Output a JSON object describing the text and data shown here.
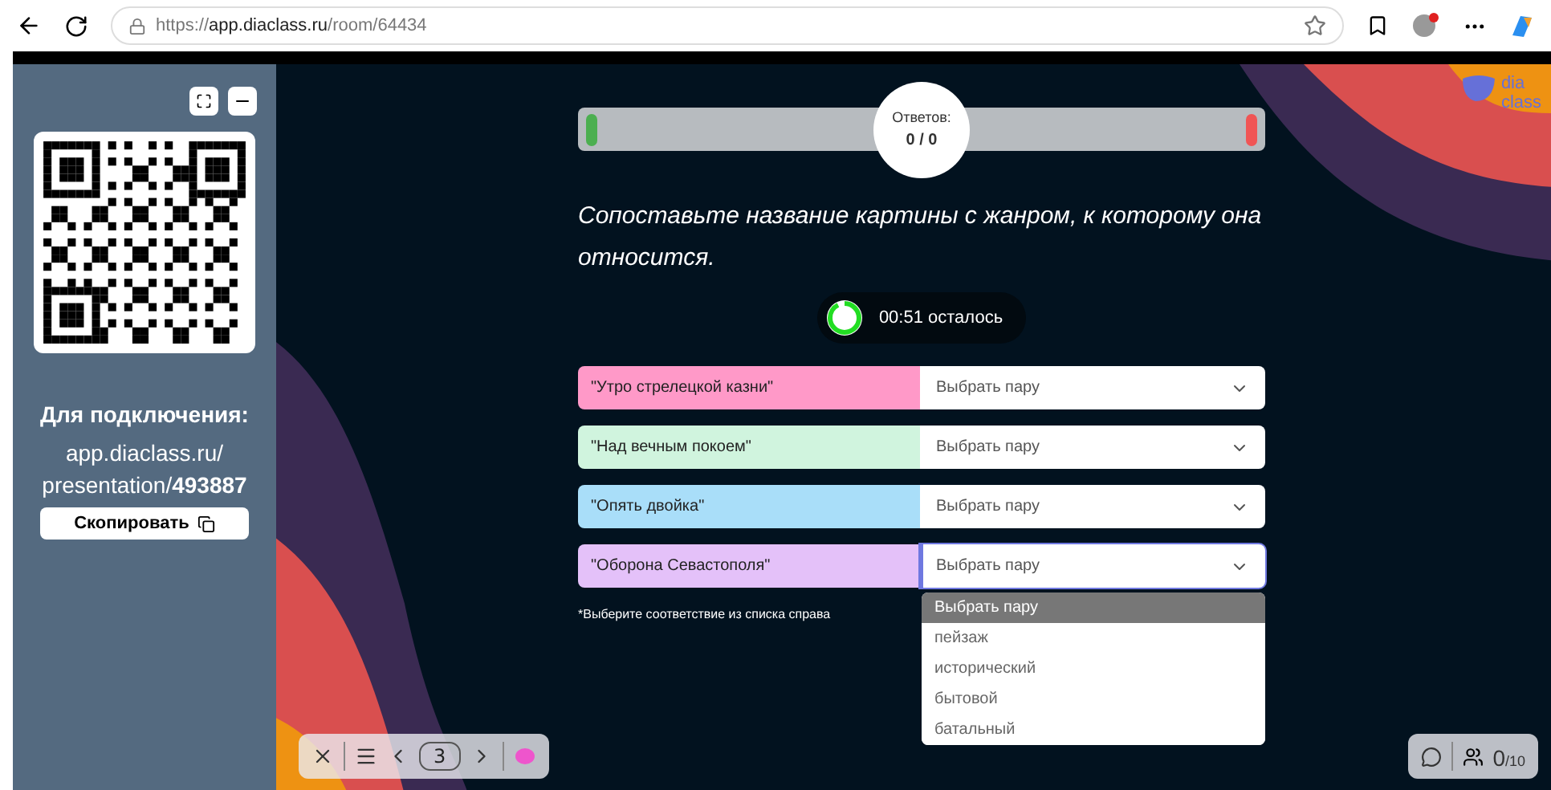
{
  "browser": {
    "url_scheme": "https://",
    "url_host": "app.diaclass.ru",
    "url_path": "/room/64434"
  },
  "sidebar": {
    "connect_title": "Для подключения:",
    "connect_host": "app.diaclass.ru/",
    "connect_path": "presentation/**493887**",
    "copy_button": "Скопировать"
  },
  "logo": {
    "line_1": "dia",
    "line_2": "class"
  },
  "answers": {
    "label": "Ответов:",
    "count": "0 / 0"
  },
  "question": "Сопоставьте название картины с жанром, к которому она относится.",
  "timer": {
    "level": 0.92,
    "text": "00:51 осталось"
  },
  "pairs": [
    {
      "label": "\"Утро стрелецкой казни\"",
      "color": "#ff99c8",
      "value": "Выбрать пару",
      "open": false
    },
    {
      "label": "\"Над вечным покоем\"",
      "color": "#d0f4de",
      "value": "Выбрать пару",
      "open": false
    },
    {
      "label": "\"Опять двойка\"",
      "color": "#a9def9",
      "value": "Выбрать пару",
      "open": false
    },
    {
      "label": "\"Оборона Севастополя\"",
      "color": "#e4c1f9",
      "value": "Выбрать пару",
      "open": true
    }
  ],
  "note": "*Выберите соответствие из списка справа",
  "dropdown_options": [
    {
      "label": "Выбрать пару",
      "selected": true
    },
    {
      "label": "пейзаж",
      "selected": false
    },
    {
      "label": "исторический",
      "selected": false
    },
    {
      "label": "бытовой",
      "selected": false
    },
    {
      "label": "батальный",
      "selected": false
    }
  ],
  "slide_nav": {
    "page": "3"
  },
  "participants": {
    "count": "0",
    "limit": "/10"
  }
}
